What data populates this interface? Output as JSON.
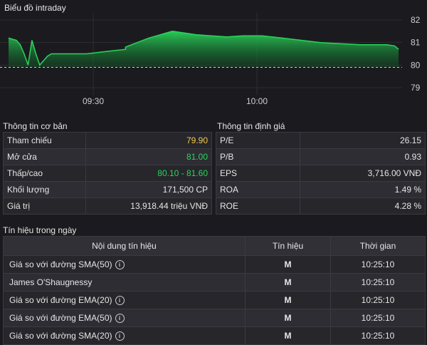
{
  "chart": {
    "title": "Biểu đồ intraday",
    "y_ticks": [
      "82",
      "81",
      "80",
      "79"
    ],
    "x_ticks": [
      "09:30",
      "10:00"
    ],
    "reference": "79.90",
    "line_color": "#2bd45b",
    "reference_color": "#cfcfcf"
  },
  "chart_data": {
    "type": "area",
    "ylim": [
      79,
      82
    ],
    "x_ticks": [
      "09:30",
      "10:00"
    ],
    "y_ticks": [
      82,
      81,
      80,
      79
    ],
    "reference_value": 79.9,
    "points": [
      [
        0,
        81.2
      ],
      [
        0.02,
        81.1
      ],
      [
        0.03,
        80.9
      ],
      [
        0.04,
        80.5
      ],
      [
        0.05,
        80.0
      ],
      [
        0.06,
        81.1
      ],
      [
        0.07,
        80.5
      ],
      [
        0.08,
        80.0
      ],
      [
        0.09,
        80.2
      ],
      [
        0.1,
        80.4
      ],
      [
        0.11,
        80.5
      ],
      [
        0.15,
        80.5
      ],
      [
        0.2,
        80.5
      ],
      [
        0.25,
        80.6
      ],
      [
        0.3,
        80.7
      ],
      [
        0.3,
        80.8
      ],
      [
        0.33,
        81.0
      ],
      [
        0.36,
        81.2
      ],
      [
        0.38,
        81.3
      ],
      [
        0.4,
        81.4
      ],
      [
        0.42,
        81.5
      ],
      [
        0.44,
        81.45
      ],
      [
        0.46,
        81.4
      ],
      [
        0.48,
        81.35
      ],
      [
        0.52,
        81.3
      ],
      [
        0.56,
        81.25
      ],
      [
        0.6,
        81.3
      ],
      [
        0.65,
        81.3
      ],
      [
        0.7,
        81.2
      ],
      [
        0.75,
        81.1
      ],
      [
        0.8,
        81.0
      ],
      [
        0.85,
        80.95
      ],
      [
        0.9,
        80.9
      ],
      [
        0.94,
        80.9
      ],
      [
        0.97,
        80.9
      ],
      [
        0.99,
        80.85
      ],
      [
        1,
        80.7
      ]
    ]
  },
  "basic": {
    "title": "Thông tin cơ bản",
    "rows": [
      {
        "label": "Tham chiếu",
        "value": "79.90",
        "color": "yellow"
      },
      {
        "label": "Mở cửa",
        "value": "81.00",
        "color": "green"
      },
      {
        "label": "Thấp/cao",
        "value": "80.10 - 81.60",
        "color": "green"
      },
      {
        "label": "Khối lượng",
        "value": "171,500 CP",
        "color": ""
      },
      {
        "label": "Giá trị",
        "value": "13,918.44 triệu VNĐ",
        "color": ""
      }
    ]
  },
  "valuation": {
    "title": "Thông tin định giá",
    "rows": [
      {
        "label": "P/E",
        "value": "26.15"
      },
      {
        "label": "P/B",
        "value": "0.93"
      },
      {
        "label": "EPS",
        "value": "3,716.00 VNĐ"
      },
      {
        "label": "ROA",
        "value": "1.49 %"
      },
      {
        "label": "ROE",
        "value": "4.28 %"
      }
    ]
  },
  "signals": {
    "title": "Tín hiệu trong ngày",
    "headers": [
      "Nội dung tín hiệu",
      "Tín hiệu",
      "Thời gian"
    ],
    "rows": [
      {
        "content": "Giá so với đường SMA(50)",
        "info": true,
        "signal": "M",
        "time": "10:25:10"
      },
      {
        "content": "James O'Shaugnessy",
        "info": false,
        "signal": "M",
        "time": "10:25:10"
      },
      {
        "content": "Giá so với đường EMA(20)",
        "info": true,
        "signal": "M",
        "time": "10:25:10"
      },
      {
        "content": "Giá so với đường EMA(50)",
        "info": true,
        "signal": "M",
        "time": "10:25:10"
      },
      {
        "content": "Giá so với đường SMA(20)",
        "info": true,
        "signal": "M",
        "time": "10:25:10"
      }
    ],
    "info_icon": "info-icon"
  }
}
